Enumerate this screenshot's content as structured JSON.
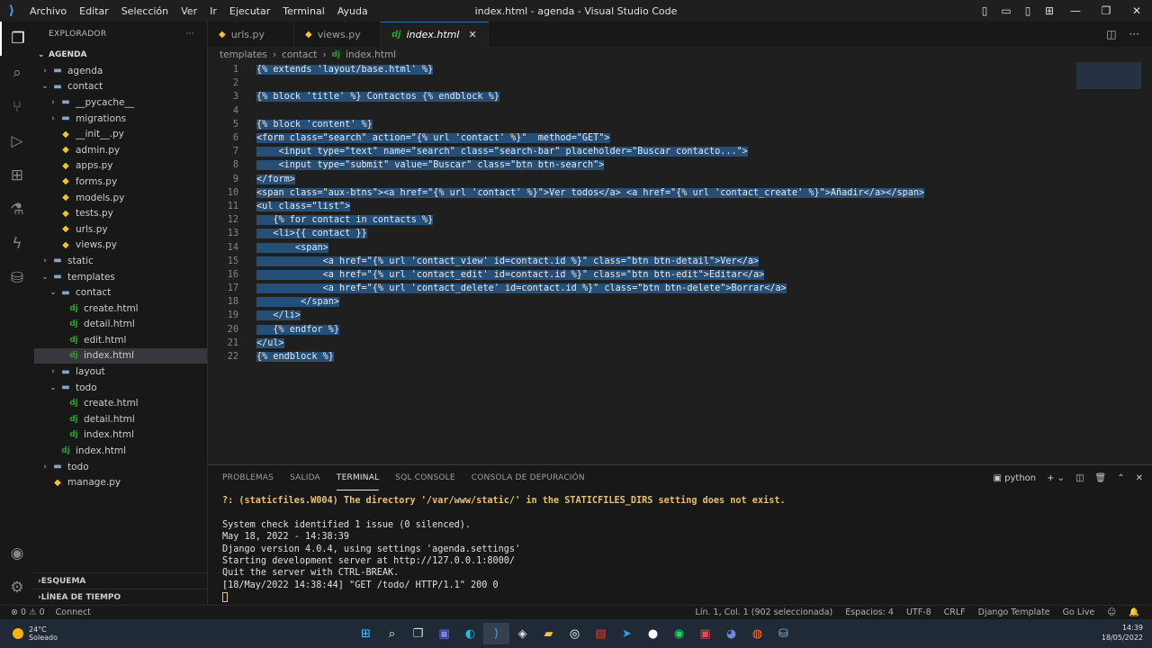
{
  "titlebar": {
    "menu": [
      "Archivo",
      "Editar",
      "Selección",
      "Ver",
      "Ir",
      "Ejecutar",
      "Terminal",
      "Ayuda"
    ],
    "window_title": "index.html - agenda - Visual Studio Code"
  },
  "sidebar": {
    "header": "EXPLORADOR",
    "root": "AGENDA",
    "tree": [
      {
        "label": "agenda",
        "type": "folder",
        "depth": 1,
        "open": false
      },
      {
        "label": "contact",
        "type": "folder",
        "depth": 1,
        "open": true
      },
      {
        "label": "__pycache__",
        "type": "folder",
        "depth": 2,
        "open": false
      },
      {
        "label": "migrations",
        "type": "folder",
        "depth": 2,
        "open": false
      },
      {
        "label": "__init__.py",
        "type": "py",
        "depth": 2
      },
      {
        "label": "admin.py",
        "type": "py",
        "depth": 2
      },
      {
        "label": "apps.py",
        "type": "py",
        "depth": 2
      },
      {
        "label": "forms.py",
        "type": "py",
        "depth": 2
      },
      {
        "label": "models.py",
        "type": "py",
        "depth": 2
      },
      {
        "label": "tests.py",
        "type": "py",
        "depth": 2
      },
      {
        "label": "urls.py",
        "type": "py",
        "depth": 2
      },
      {
        "label": "views.py",
        "type": "py",
        "depth": 2
      },
      {
        "label": "static",
        "type": "folder",
        "depth": 1,
        "open": false
      },
      {
        "label": "templates",
        "type": "folder",
        "depth": 1,
        "open": true
      },
      {
        "label": "contact",
        "type": "folder",
        "depth": 2,
        "open": true
      },
      {
        "label": "create.html",
        "type": "dj",
        "depth": 3
      },
      {
        "label": "detail.html",
        "type": "dj",
        "depth": 3
      },
      {
        "label": "edit.html",
        "type": "dj",
        "depth": 3
      },
      {
        "label": "index.html",
        "type": "dj",
        "depth": 3,
        "selected": true
      },
      {
        "label": "layout",
        "type": "folder",
        "depth": 2,
        "open": false
      },
      {
        "label": "todo",
        "type": "folder",
        "depth": 2,
        "open": true
      },
      {
        "label": "create.html",
        "type": "dj",
        "depth": 3
      },
      {
        "label": "detail.html",
        "type": "dj",
        "depth": 3
      },
      {
        "label": "index.html",
        "type": "dj",
        "depth": 3
      },
      {
        "label": "index.html",
        "type": "dj",
        "depth": 2
      },
      {
        "label": "todo",
        "type": "folder",
        "depth": 1,
        "open": false
      },
      {
        "label": "manage.py",
        "type": "py",
        "depth": 1
      }
    ],
    "bottom_sections": [
      "ESQUEMA",
      "LÍNEA DE TIEMPO"
    ]
  },
  "tabs": [
    {
      "label": "urls.py",
      "icon": "py",
      "active": false
    },
    {
      "label": "views.py",
      "icon": "py",
      "active": false
    },
    {
      "label": "index.html",
      "icon": "dj",
      "active": true
    }
  ],
  "breadcrumb": [
    "templates",
    "contact",
    "index.html"
  ],
  "code": [
    "{% extends 'layout/base.html' %}",
    "",
    "{% block 'title' %} Contactos {% endblock %}",
    "",
    "{% block 'content' %}",
    "<form class=\"search\" action=\"{% url 'contact' %}\"  method=\"GET\">",
    "    <input type=\"text\" name=\"search\" class=\"search-bar\" placeholder=\"Buscar contacto...\">",
    "    <input type=\"submit\" value=\"Buscar\" class=\"btn btn-search\">",
    "</form>",
    "<span class=\"aux-btns\"><a href=\"{% url 'contact' %}\">Ver todos</a> <a href=\"{% url 'contact_create' %}\">Añadir</a></span>",
    "<ul class=\"list\">",
    "   {% for contact in contacts %}",
    "   <li>{{ contact }}",
    "       <span>",
    "            <a href=\"{% url 'contact_view' id=contact.id %}\" class=\"btn btn-detail\">Ver</a>",
    "            <a href=\"{% url 'contact_edit' id=contact.id %}\" class=\"btn btn-edit\">Editar</a>",
    "            <a href=\"{% url 'contact_delete' id=contact.id %}\" class=\"btn btn-delete\">Borrar</a>",
    "        </span>",
    "   </li>",
    "   {% endfor %}",
    "</ul>",
    "{% endblock %}"
  ],
  "panel": {
    "tabs": [
      "PROBLEMAS",
      "SALIDA",
      "TERMINAL",
      "SQL CONSOLE",
      "CONSOLA DE DEPURACIÓN"
    ],
    "active_tab": "TERMINAL",
    "shell_label": "python",
    "lines": [
      {
        "text": "?: (staticfiles.W004) The directory '/var/www/static/' in the STATICFILES_DIRS setting does not exist.",
        "warn": true
      },
      {
        "text": "",
        "warn": false
      },
      {
        "text": "System check identified 1 issue (0 silenced).",
        "warn": false
      },
      {
        "text": "May 18, 2022 - 14:38:39",
        "warn": false
      },
      {
        "text": "Django version 4.0.4, using settings 'agenda.settings'",
        "warn": false
      },
      {
        "text": "Starting development server at http://127.0.0.1:8000/",
        "warn": false
      },
      {
        "text": "Quit the server with CTRL-BREAK.",
        "warn": false
      },
      {
        "text": "[18/May/2022 14:38:44] \"GET /todo/ HTTP/1.1\" 200 0",
        "warn": false
      }
    ]
  },
  "statusbar": {
    "left": [
      "⊗ 0 ⚠ 0",
      "Connect"
    ],
    "right": [
      "Lín. 1, Col. 1 (902 seleccionada)",
      "Espacios: 4",
      "UTF-8",
      "CRLF",
      "Django Template",
      "Go Live"
    ]
  },
  "taskbar": {
    "temperature": "24°C",
    "weather": "Soleado",
    "time": "14:39",
    "date": "18/05/2022"
  }
}
